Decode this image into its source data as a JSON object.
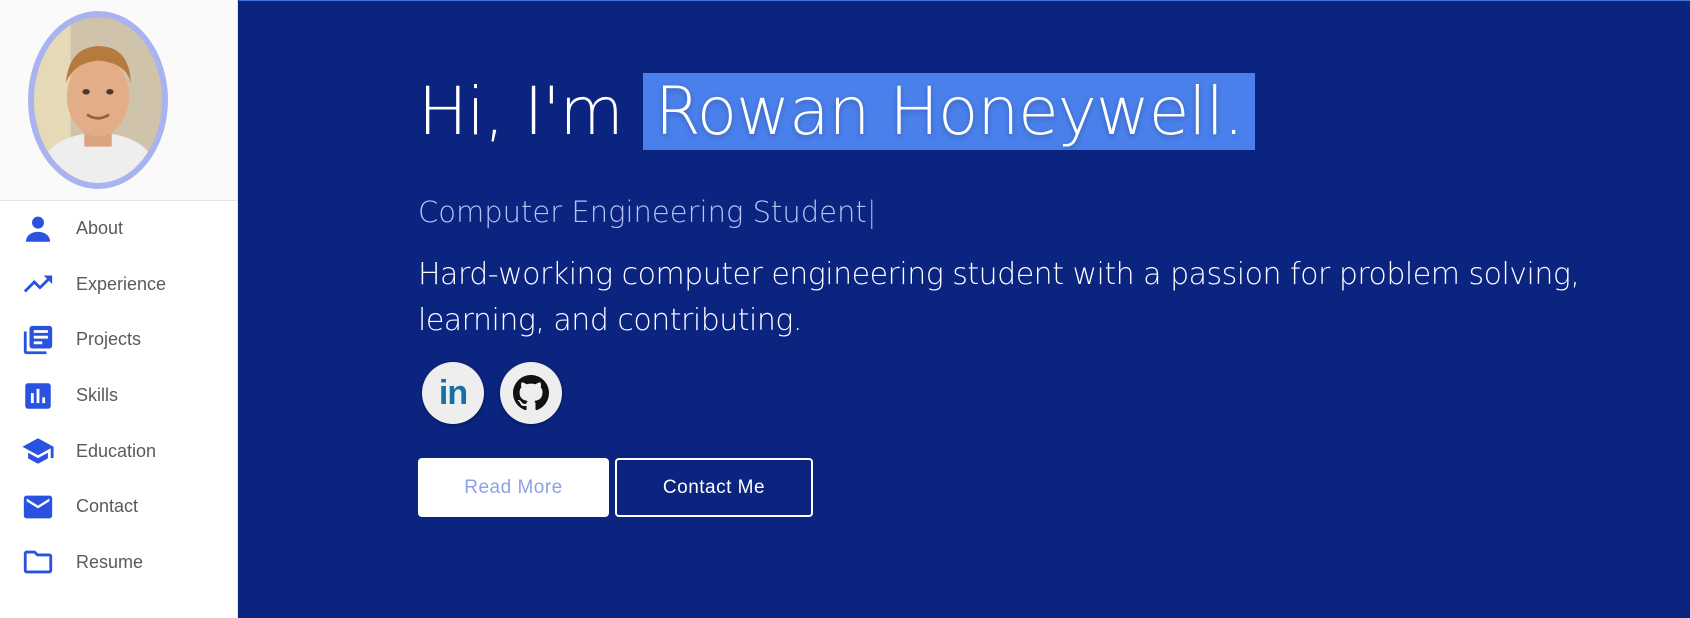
{
  "sidebar": {
    "items": [
      {
        "label": "About",
        "icon": "person-icon"
      },
      {
        "label": "Experience",
        "icon": "trending-up-icon"
      },
      {
        "label": "Projects",
        "icon": "library-books-icon"
      },
      {
        "label": "Skills",
        "icon": "bar-chart-icon"
      },
      {
        "label": "Education",
        "icon": "school-icon"
      },
      {
        "label": "Contact",
        "icon": "mail-icon"
      },
      {
        "label": "Resume",
        "icon": "folder-icon"
      }
    ]
  },
  "hero": {
    "greeting": "Hi, I'm",
    "name": "Rowan Honeywell.",
    "subtitle": "Computer Engineering Student",
    "cursor": "|",
    "blurb": "Hard-working computer engineering student with a passion for problem solving, learning, and contributing.",
    "linkedin_label": "in",
    "read_more_label": "Read More",
    "contact_label": "Contact Me"
  },
  "colors": {
    "main_bg": "#0a2480",
    "accent_blue": "#2a52e0",
    "highlight": "#4a80ec"
  }
}
